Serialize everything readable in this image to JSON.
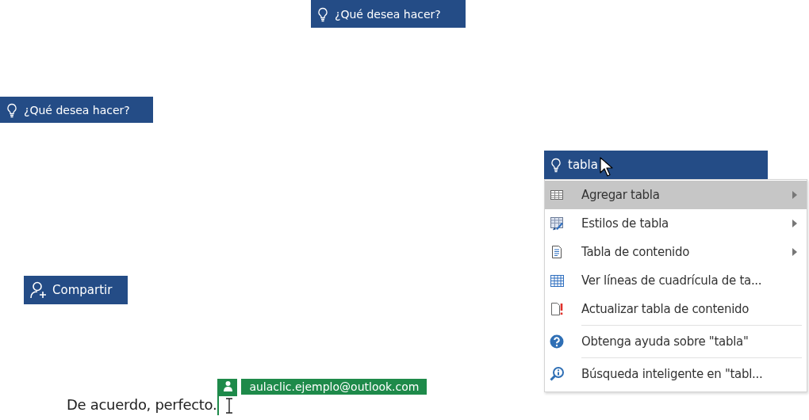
{
  "tell_me_boxes": [
    {
      "placeholder": "¿Qué desea hacer?"
    },
    {
      "placeholder": "¿Qué desea hacer?"
    }
  ],
  "search": {
    "value": "tabla"
  },
  "menu": {
    "items": [
      {
        "label": "Agregar tabla",
        "kind": "table",
        "selected": true,
        "submenu": true,
        "separator_before": false
      },
      {
        "label": "Estilos de tabla",
        "kind": "styles",
        "selected": false,
        "submenu": true,
        "separator_before": false
      },
      {
        "label": "Tabla de contenido",
        "kind": "doc",
        "selected": false,
        "submenu": true,
        "separator_before": false
      },
      {
        "label": "Ver líneas de cuadrícula de ta...",
        "kind": "grid",
        "selected": false,
        "submenu": false,
        "separator_before": false
      },
      {
        "label": "Actualizar tabla de contenido",
        "kind": "update",
        "selected": false,
        "submenu": false,
        "separator_before": false
      },
      {
        "label": "Obtenga ayuda sobre \"tabla\"",
        "kind": "help",
        "selected": false,
        "submenu": false,
        "separator_before": true
      },
      {
        "label": "Búsqueda inteligente en \"tabl...",
        "kind": "smart",
        "selected": false,
        "submenu": false,
        "separator_before": true
      }
    ]
  },
  "share_button": {
    "label": "Compartir"
  },
  "document": {
    "text": "De acuerdo, perfecto.",
    "coauthor": "aulaclic.ejemplo@outlook.com"
  }
}
